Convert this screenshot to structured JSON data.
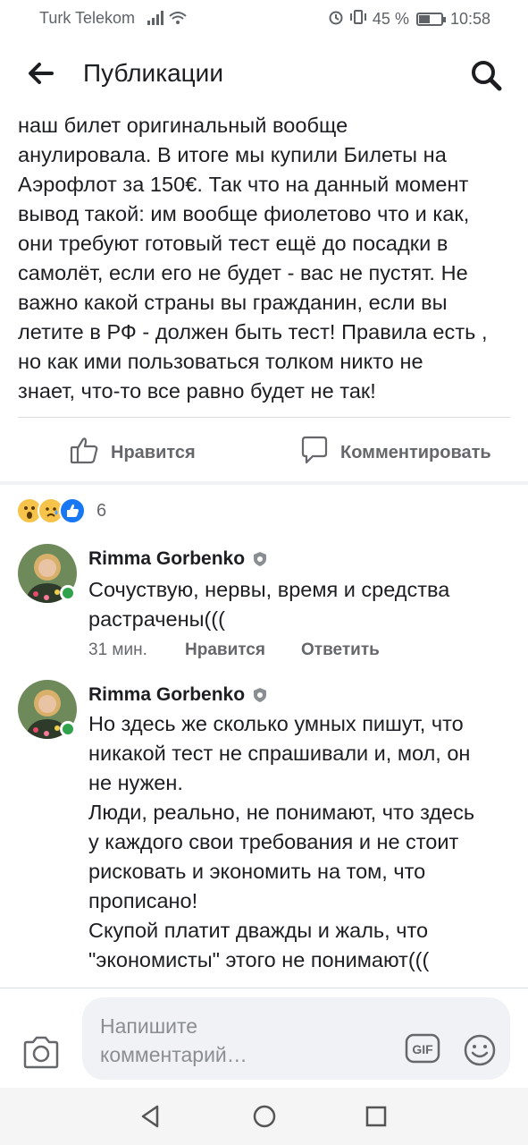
{
  "status_bar": {
    "carrier": "Turk Telekom",
    "battery": "45 %",
    "time": "10:58"
  },
  "header": {
    "title": "Публикации"
  },
  "post": {
    "text": "наш билет оригинальный вообще\nанулировала. В итоге мы купили Билеты  на\nАэрофлот за 150€.  Так что на данный момент\nвывод такой: им вообще фиолетово что и как,\nони требуют готовый тест ещё до посадки в\nсамолёт, если его не будет - вас не пустят. Не\nважно какой страны вы гражданин, если вы\nлетите в РФ - должен быть тест! Правила есть ,\nно как ими пользоваться толком никто не\nзнает, что-то все равно будет не так!",
    "like_label": "Нравится",
    "comment_label": "Комментировать",
    "reaction_count": "6"
  },
  "comments": [
    {
      "author": "Rimma Gorbenko",
      "text": "Сочуствую, нервы, время и средства\nрастрачены(((",
      "time": "31 мин.",
      "like": "Нравится",
      "reply": "Ответить"
    },
    {
      "author": "Rimma Gorbenko",
      "text": "Но здесь же сколько умных пишут, что\nникакой тест не спрашивали и, мол, он\nне нужен.\nЛюди, реально, не понимают, что здесь\nу каждого свои требования и не стоит\nрисковать и экономить на том, что\nпрописано!\nСкупой платит дважды и жаль, что\n\"экономисты\" этого не понимают((("
    }
  ],
  "composer": {
    "placeholder": "Напишите\nкомментарий…",
    "gif_label": "GIF"
  },
  "icons": {
    "back": "arrow-left-icon",
    "search": "search-icon",
    "like": "thumbs-up-icon",
    "comment": "speech-bubble-icon",
    "camera": "camera-icon",
    "emoji": "smiley-icon"
  },
  "colors": {
    "accent": "#1877f2",
    "online": "#31a24c",
    "secondary_text": "#65676b"
  }
}
